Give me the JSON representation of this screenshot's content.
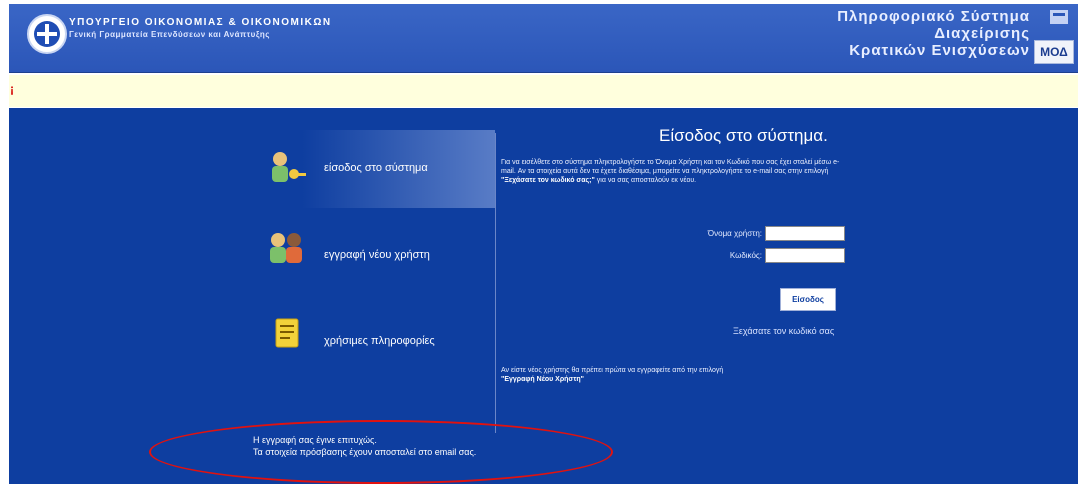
{
  "header": {
    "ministry_line1": "ΥΠΟΥΡΓΕΙΟ ΟΙΚΟΝΟΜΙΑΣ & ΟΙΚΟΝΟΜΙΚΩΝ",
    "ministry_line2": "Γενική Γραμματεία Επενδύσεων και Ανάπτυξης",
    "system_line1": "Πληροφοριακό Σύστημα",
    "system_line2": "Διαχείρισης",
    "system_line3": "Κρατικών Ενισχύσεων",
    "badge": "ΜΟΔ"
  },
  "menu": [
    {
      "label": "είσοδος στο σύστημα",
      "icon": "login-key-user-icon"
    },
    {
      "label": "εγγραφή νέου χρήστη",
      "icon": "new-users-icon"
    },
    {
      "label": "χρήσιμες πληροφορίες",
      "icon": "info-note-icon"
    }
  ],
  "login": {
    "title": "Είσοδος στο σύστημα.",
    "info_1": "Για να εισέλθετε στο σύστημα πληκτρολογήστε το Όνομα Χρήστη και τον Κωδικό που σας έχει σταλεί μέσω e-mail.",
    "info_2": "Αν τα στοιχεία αυτά δεν τα έχετε διαθέσιμα, μπορείτε να πληκτρολογήστε το e-mail σας στην επιλογή",
    "info_link": "\"Ξεχάσατε τον κωδικό σας;\"",
    "info_3": "για να σας αποσταλούν εκ νέου.",
    "username_label": "Όνομα χρήστη:",
    "password_label": "Κωδικός:",
    "username_value": "",
    "password_value": "",
    "submit_label": "Είσοδος",
    "forgot_label": "Ξεχάσατε τον κωδικό σας",
    "note_1": "Αν είστε νέος χρήστης θα πρέπει πρώτα να εγγραφείτε από την επιλογή",
    "note_link": "\"Εγγραφή Νέου Χρήστη\""
  },
  "success": {
    "line1": "Η εγγραφή σας έγινε επιτυχώς.",
    "line2": "Τα στοιχεία πρόσβασης έχουν αποσταλεί στο email σας."
  },
  "colors": {
    "header_blue": "#2b56b8",
    "main_blue": "#0e3ea0",
    "strip_yellow": "#ffffdd",
    "highlight_red": "#e1120f"
  }
}
